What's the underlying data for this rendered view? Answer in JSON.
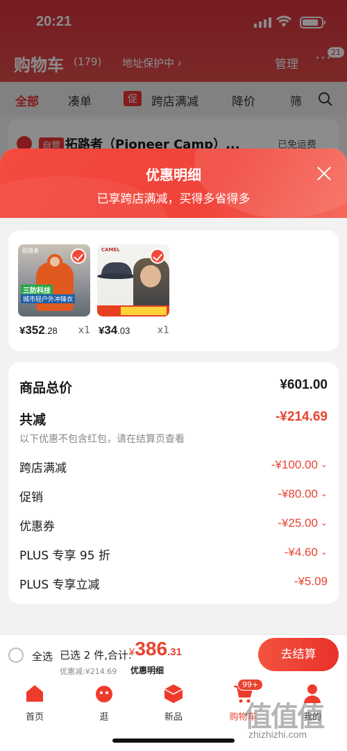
{
  "status_bar": {
    "time": "20:21"
  },
  "cart_header": {
    "title": "购物车",
    "count": "(179)",
    "address": "地址保护中 ›",
    "manage": "管理",
    "more": "···",
    "more_badge": "21"
  },
  "cart_tabs": [
    "全部",
    "凑单",
    "跨店满减",
    "降价",
    "筛"
  ],
  "cart_tab_promo_tag": "促",
  "store": {
    "self_tag": "自营",
    "name": "拓路者（Pioneer Camp）...",
    "shipping": "已免运费"
  },
  "sheet": {
    "title": "优惠明细",
    "subtitle": "已享跨店满减，买得多省得多"
  },
  "products": [
    {
      "price_symbol": "¥",
      "price_int": "352",
      "price_dec": ".28",
      "qty": "x1",
      "brand": "拓路者",
      "label1": "三防科技",
      "label2": "城市轻户外冲锋衣"
    },
    {
      "price_symbol": "¥",
      "price_int": "34",
      "price_dec": ".03",
      "qty": "x1",
      "brand": "CAMEL"
    }
  ],
  "summary": {
    "total_label": "商品总价",
    "total_value": "¥601.00",
    "reduce_label": "共减",
    "reduce_value": "-¥214.69",
    "hint": "以下优惠不包含红包，请在结算页查看",
    "items": [
      {
        "label": "跨店满减",
        "value": "-¥100.00"
      },
      {
        "label": "促销",
        "value": "-¥80.00"
      },
      {
        "label": "优惠券",
        "value": "-¥25.00"
      },
      {
        "label": "PLUS 专享 95 折",
        "value": "-¥4.60"
      },
      {
        "label": "PLUS 专享立减",
        "value": "-¥5.09"
      }
    ]
  },
  "bottom_bar": {
    "select_all": "全选",
    "selected": "已选 2 件,合计:",
    "sum_symbol": "¥",
    "sum_int": "386",
    "sum_dec": ".31",
    "discount": "优惠减:¥214.69",
    "detail_link": "优惠明细",
    "checkout": "去结算"
  },
  "tabbar": [
    {
      "label": "首页",
      "icon": "home-icon"
    },
    {
      "label": "逛",
      "icon": "stroll-icon"
    },
    {
      "label": "新品",
      "icon": "new-products-icon"
    },
    {
      "label": "购物车",
      "icon": "cart-icon",
      "badge": "99+"
    },
    {
      "label": "我的",
      "icon": "profile-icon"
    }
  ],
  "watermark": {
    "logo": "值值值",
    "text": "zhizhizhi.com"
  },
  "colors": {
    "accent": "#e8432f",
    "header": "#f44a3f"
  }
}
